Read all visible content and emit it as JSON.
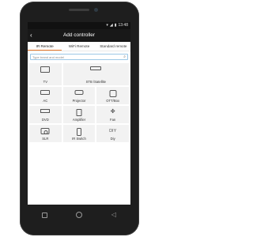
{
  "status_bar": {
    "icons": [
      "wifi-icon",
      "signal-icon",
      "battery-icon"
    ],
    "time": "13:48"
  },
  "app_bar": {
    "title": "Add controller",
    "back_icon": "chevron-left-icon"
  },
  "tabs": [
    {
      "label": "IR Remote",
      "active": true
    },
    {
      "label": "WiFi Remote",
      "active": false
    },
    {
      "label": "Standard remote",
      "active": false
    }
  ],
  "search": {
    "placeholder": "Type brand and model",
    "value": ""
  },
  "devices": [
    {
      "label": "TV",
      "icon": "tv-icon"
    },
    {
      "label": "STB /Satellite",
      "icon": "set-top-box-icon"
    },
    {
      "label": "AC",
      "icon": "air-conditioner-icon"
    },
    {
      "label": "Projector",
      "icon": "projector-icon"
    },
    {
      "label": "OTT/Box",
      "icon": "ott-box-icon"
    },
    {
      "label": "DVD",
      "icon": "dvd-player-icon"
    },
    {
      "label": "Amplifier",
      "icon": "amplifier-icon"
    },
    {
      "label": "Fan",
      "icon": "fan-icon"
    },
    {
      "label": "SLR",
      "icon": "camera-icon"
    },
    {
      "label": "IR Switch",
      "icon": "ir-switch-icon"
    },
    {
      "label": "Diy",
      "icon_text": "DIY"
    }
  ],
  "colors": {
    "accent": "#e8782a",
    "search_border": "#9cc7e6",
    "tile_bg": "#f2f2f2",
    "app_bar_bg": "#181818"
  }
}
